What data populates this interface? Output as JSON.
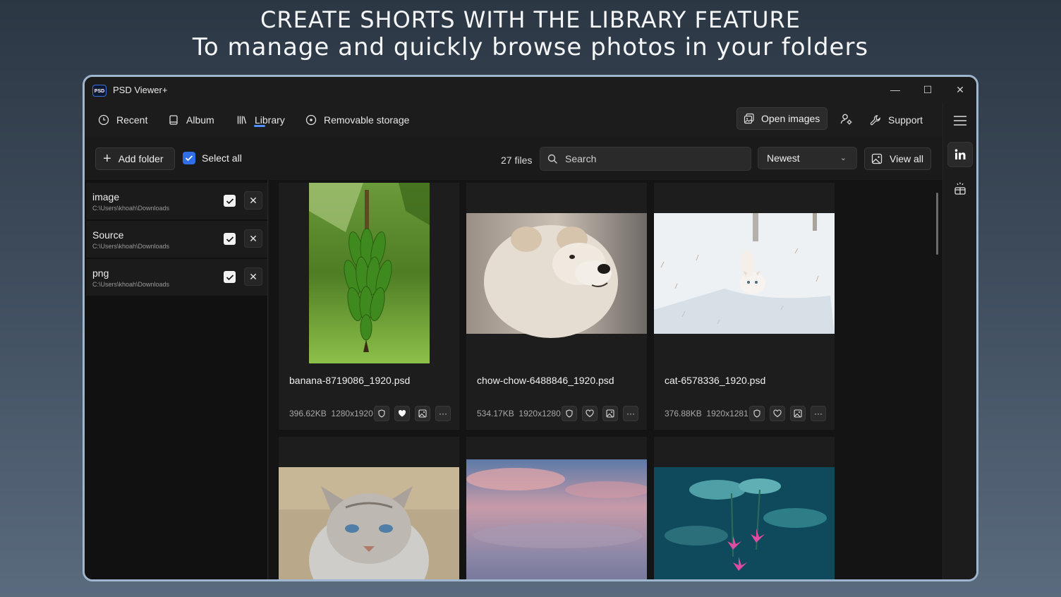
{
  "headline": {
    "line1": "CREATE SHORTS WITH THE LIBRARY FEATURE",
    "line2": "To manage and quickly browse photos in your folders"
  },
  "window": {
    "logo_text": "PSD",
    "title": "PSD Viewer+",
    "minimize": "—",
    "maximize": "☐",
    "close": "✕"
  },
  "nav": {
    "items": [
      {
        "label": "Recent",
        "icon": "clock-icon"
      },
      {
        "label": "Album",
        "icon": "album-icon"
      },
      {
        "label": "Library",
        "icon": "library-icon",
        "active": true
      },
      {
        "label": "Removable storage",
        "icon": "disc-icon"
      }
    ],
    "open_images": "Open images",
    "support": "Support"
  },
  "toolbar": {
    "add_folder": "Add folder",
    "select_all": "Select all",
    "files_count": "27 files",
    "search_placeholder": "Search",
    "sort_value": "Newest",
    "view_all": "View all"
  },
  "folders": [
    {
      "name": "image",
      "path": "C:\\Users\\khoah\\Downloads",
      "checked": true
    },
    {
      "name": "Source",
      "path": "C:\\Users\\khoah\\Downloads",
      "checked": true
    },
    {
      "name": "png",
      "path": "C:\\Users\\khoah\\Downloads",
      "checked": true
    }
  ],
  "files": [
    {
      "name": "banana-8719086_1920.psd",
      "size": "396.62KB",
      "dims": "1280x1920",
      "favorite": true,
      "thumb": "green banana bunch"
    },
    {
      "name": "chow-chow-6488846_1920.psd",
      "size": "534.17KB",
      "dims": "1920x1280",
      "favorite": false,
      "thumb": "white chow chow dog"
    },
    {
      "name": "cat-6578336_1920.psd",
      "size": "376.88KB",
      "dims": "1920x1281",
      "favorite": false,
      "thumb": "white cat in snow"
    },
    {
      "thumb": "grey tabby cat"
    },
    {
      "thumb": "pink sunset clouds"
    },
    {
      "thumb": "lotus leaves and pink flowers"
    }
  ],
  "colors": {
    "accent": "#4c8dff",
    "checkbox_blue": "#2f6ee8",
    "window_bg": "#1c1c1c",
    "window_border": "#9fb6cf"
  }
}
